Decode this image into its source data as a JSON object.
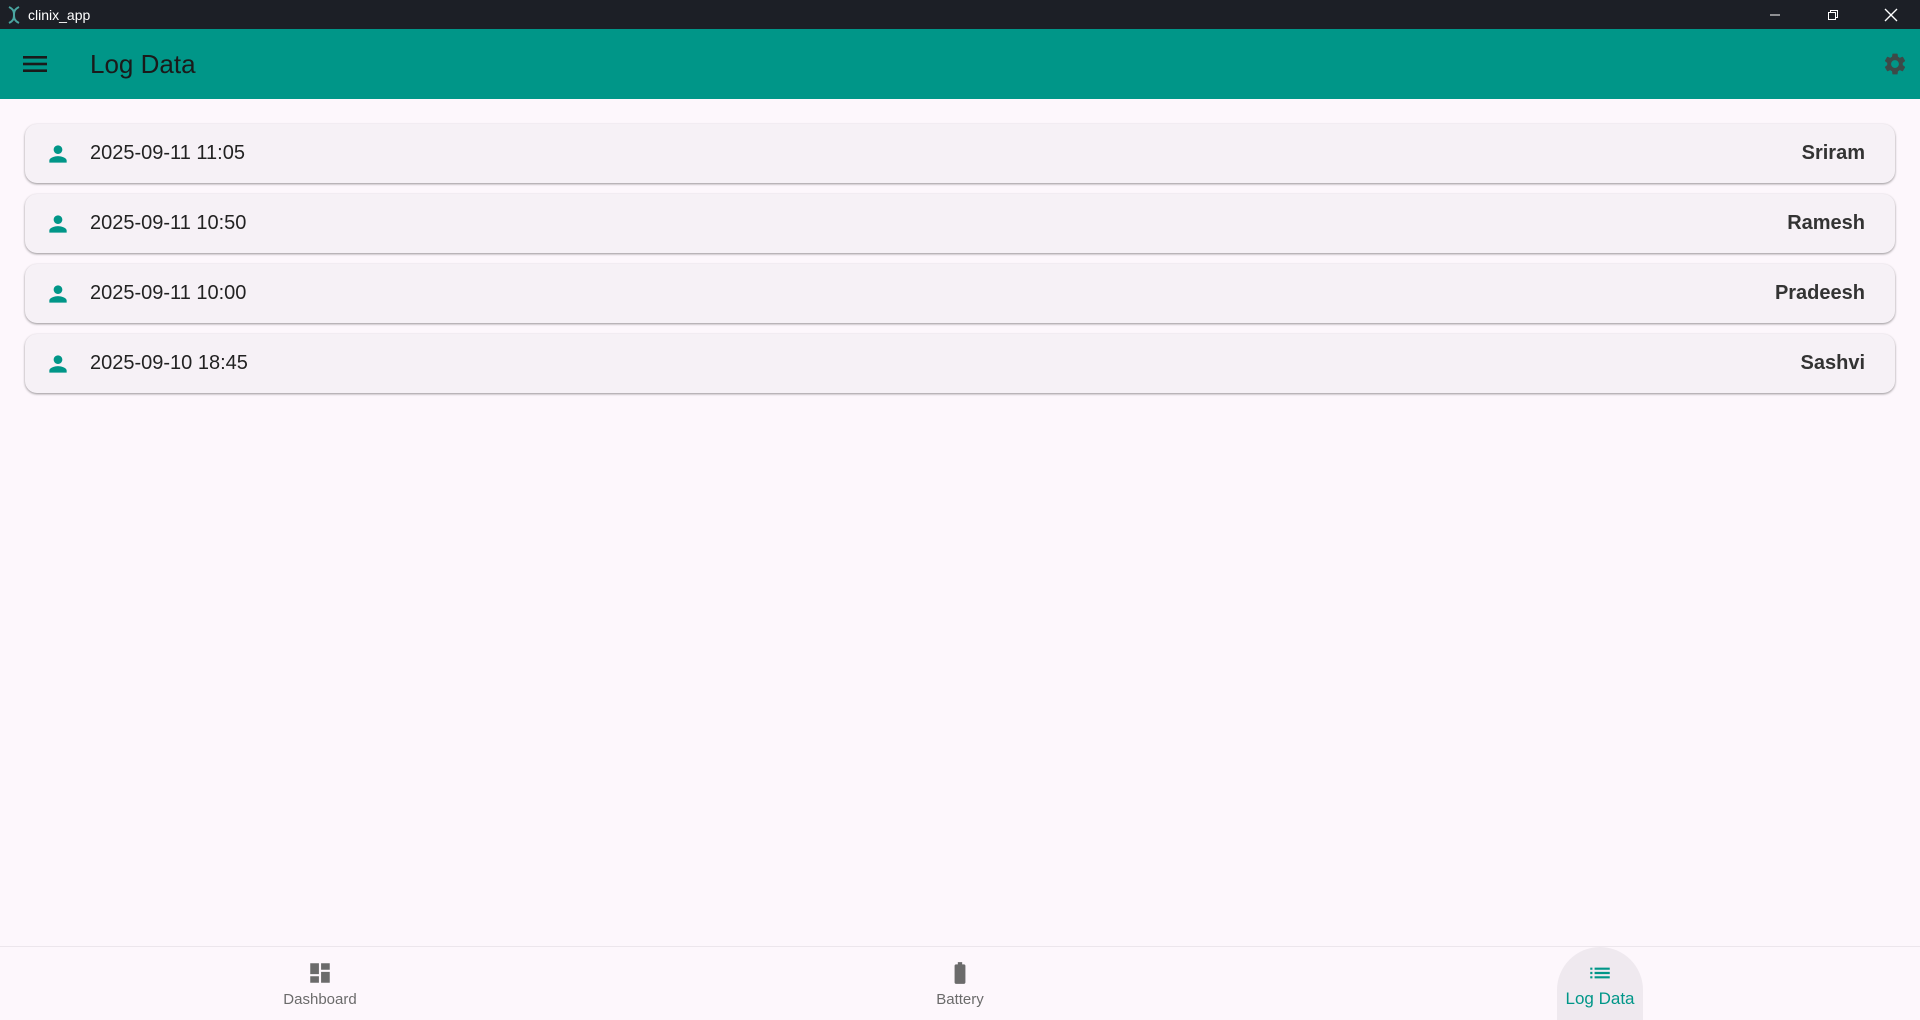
{
  "window": {
    "title": "clinix_app",
    "app_icon": "helix-icon"
  },
  "appbar": {
    "title": "Log Data",
    "menu_icon": "hamburger-menu-icon",
    "settings_icon": "gear-icon",
    "background_color": "#009688"
  },
  "log_entries": [
    {
      "timestamp": "2025-09-11 11:05",
      "name": "Sriram"
    },
    {
      "timestamp": "2025-09-11 10:50",
      "name": "Ramesh"
    },
    {
      "timestamp": "2025-09-11 10:00",
      "name": "Pradeesh"
    },
    {
      "timestamp": "2025-09-10 18:45",
      "name": "Sashvi"
    }
  ],
  "bottom_nav": {
    "items": [
      {
        "label": "Dashboard",
        "icon": "dashboard-icon",
        "active": false
      },
      {
        "label": "Battery",
        "icon": "battery-icon",
        "active": false
      },
      {
        "label": "Log Data",
        "icon": "list-icon",
        "active": true
      }
    ]
  },
  "colors": {
    "accent": "#009688",
    "background": "#fdf7fc",
    "card": "#f6f1f6",
    "titlebar": "#1c1f26"
  }
}
